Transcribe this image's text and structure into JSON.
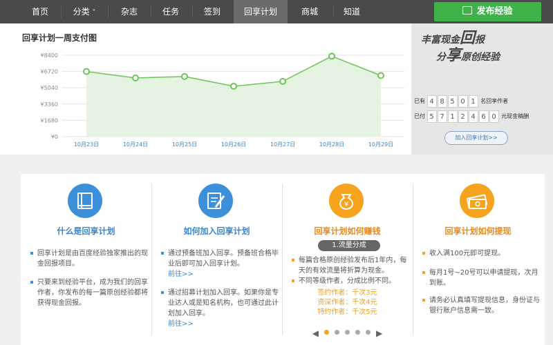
{
  "nav": {
    "items": [
      "首页",
      "分类",
      "杂志",
      "任务",
      "签到",
      "回享计划",
      "商城",
      "知道"
    ],
    "dropdown_caret": "˅",
    "active": "回享计划",
    "publish": "发布经验",
    "publish_icon": "edit-icon"
  },
  "chart_data": {
    "type": "area",
    "title": "回享计划一周支付图",
    "categories": [
      "10月23日",
      "10月24日",
      "10月25日",
      "10月26日",
      "10月27日",
      "10月28日",
      "10月29日"
    ],
    "values": [
      6720,
      6050,
      6200,
      5200,
      5700,
      8300,
      6300
    ],
    "yticks": [
      "¥8400",
      "¥6720",
      "¥5040",
      "¥3360",
      "¥1680",
      "¥0"
    ],
    "ylim": [
      0,
      8400
    ],
    "grid": true,
    "colors": {
      "line": "#6cc35a",
      "fill": "#e5f4e1"
    }
  },
  "promo": {
    "slogan_line1": "丰富现金",
    "slogan_big1": "回",
    "slogan_tail1": "报",
    "slogan_line2_pre": "分",
    "slogan_big2": "享",
    "slogan_line2_post": "原创经验",
    "row1_prefix": "已有",
    "row1_digits": [
      "4",
      "8",
      "5",
      "0",
      "1"
    ],
    "row1_suffix": "名回享作者",
    "row2_prefix": "已付",
    "row2_digits": [
      "5",
      "7",
      "1",
      "2",
      "4",
      "6",
      "0"
    ],
    "row2_suffix": "元现金稿酬",
    "join": "加入回享计划>>"
  },
  "cards": [
    {
      "title": "什么是回享计划",
      "icon": "book-icon",
      "paras": [
        "回享计划是由百度经验独家推出的现金回报项目。",
        "只要来到经验平台，成为我们的回享作者，你发布的每一篇原创经验都将获得现金回报。"
      ]
    },
    {
      "title": "如何加入回享计划",
      "icon": "edit-document-icon",
      "paras": [
        "通过预备班加入回享。预备班合格毕业后即可加入回享计划。",
        "通过招募计划加入回享。如果你是专业达人或是知名机构，也可通过此计划加入回享。"
      ],
      "link": "前往>>"
    },
    {
      "title": "回享计划如何赚钱",
      "icon": "money-bag-icon",
      "badge": "1.流量分成",
      "paras": [
        "每篇合格原创经验发布后1年内，每天的有效流量将折算为现金。",
        "不同等级作者，分成比例不同。"
      ],
      "tiers": [
        "签约作者：千次3元",
        "资深作者：千次4元",
        "特约作者：千次5元"
      ]
    },
    {
      "title": "回享计划如何提现",
      "icon": "cash-icon",
      "paras": [
        "收入满100元即可提现。",
        "每月1号~20号可以申请提现，次月到账。",
        "请务必认真填写提现信息，身份证与银行账户信息需一致。"
      ]
    }
  ],
  "carousel": {
    "prev": "◀",
    "next": "▶",
    "count": 5,
    "active": 0
  }
}
